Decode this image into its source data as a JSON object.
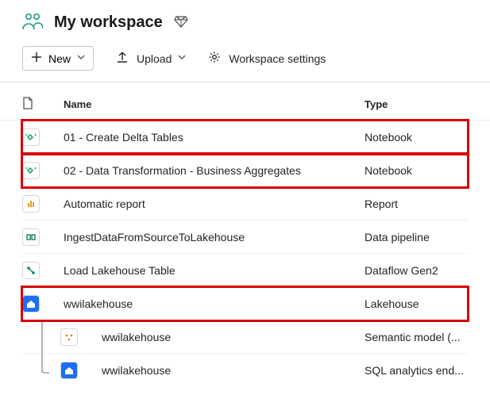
{
  "header": {
    "title": "My workspace"
  },
  "toolbar": {
    "new_label": "New",
    "upload_label": "Upload",
    "settings_label": "Workspace settings"
  },
  "columns": {
    "name": "Name",
    "type": "Type"
  },
  "items": [
    {
      "icon": "notebook",
      "name": "01 - Create Delta Tables",
      "type": "Notebook",
      "highlight": true
    },
    {
      "icon": "notebook",
      "name": "02 - Data Transformation - Business Aggregates",
      "type": "Notebook",
      "highlight": true
    },
    {
      "icon": "report",
      "name": "Automatic report",
      "type": "Report",
      "highlight": false
    },
    {
      "icon": "pipeline",
      "name": "IngestDataFromSourceToLakehouse",
      "type": "Data pipeline",
      "highlight": false
    },
    {
      "icon": "dataflow",
      "name": "Load Lakehouse Table",
      "type": "Dataflow Gen2",
      "highlight": false
    },
    {
      "icon": "lakehouse",
      "name": "wwilakehouse",
      "type": "Lakehouse",
      "highlight": true
    }
  ],
  "children": [
    {
      "icon": "semantic",
      "name": "wwilakehouse",
      "type": "Semantic model (..."
    },
    {
      "icon": "sqlend",
      "name": "wwilakehouse",
      "type": "SQL analytics end..."
    }
  ]
}
